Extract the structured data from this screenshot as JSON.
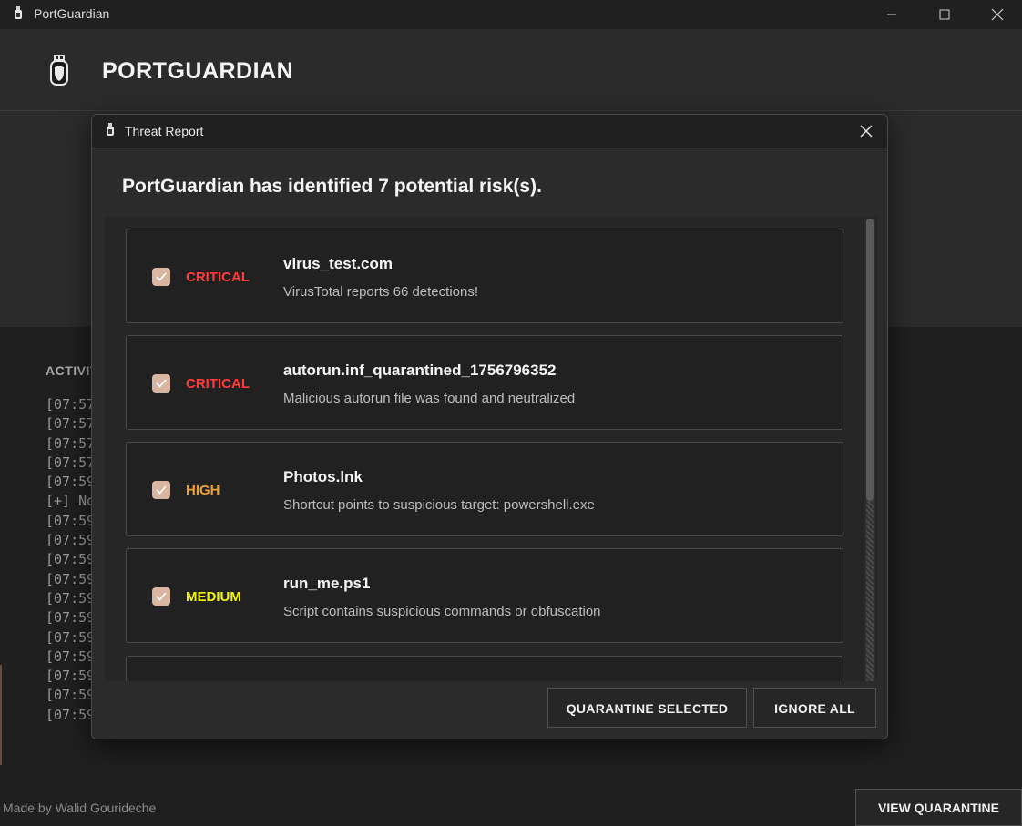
{
  "window": {
    "title": "PortGuardian",
    "minimize_glyph": "—",
    "maximize_glyph": "☐",
    "close_glyph": "✕"
  },
  "header": {
    "brand": "PORTGUARDIAN",
    "logo_icon": "usb-shield-icon"
  },
  "activity": {
    "title": "ACTIVITY",
    "log_lines": [
      "[07:57",
      "[07:57",
      "[07:57",
      "[07:57",
      "[07:59",
      "[+] No",
      "[07:59",
      "[07:59",
      "[07:59",
      "[07:59",
      "[07:59",
      "[07:59",
      "[07:59",
      "[07:59",
      "[07:59",
      "[07:59",
      "[07:59"
    ]
  },
  "footer": {
    "credit": "Made by Walid Gourideche",
    "view_quarantine_label": "VIEW QUARANTINE"
  },
  "dialog": {
    "title": "Threat Report",
    "heading": "PortGuardian has identified 7 potential risk(s).",
    "threats": [
      {
        "checked": true,
        "severity": "CRITICAL",
        "severity_color": "#ff3b3b",
        "filename": "virus_test.com",
        "description": "VirusTotal reports 66 detections!"
      },
      {
        "checked": true,
        "severity": "CRITICAL",
        "severity_color": "#ff3b3b",
        "filename": "autorun.inf_quarantined_1756796352",
        "description": "Malicious autorun file was found and neutralized"
      },
      {
        "checked": true,
        "severity": "HIGH",
        "severity_color": "#f0a030",
        "filename": "Photos.lnk",
        "description": "Shortcut points to suspicious target: powershell.exe"
      },
      {
        "checked": true,
        "severity": "MEDIUM",
        "severity_color": "#f5f500",
        "filename": "run_me.ps1",
        "description": "Script contains suspicious commands or obfuscation"
      }
    ],
    "quarantine_selected_label": "QUARANTINE SELECTED",
    "ignore_all_label": "IGNORE ALL"
  },
  "colors": {
    "checkbox": "#d9b6a1",
    "background": "#202020",
    "panel": "#2b2b2b"
  }
}
